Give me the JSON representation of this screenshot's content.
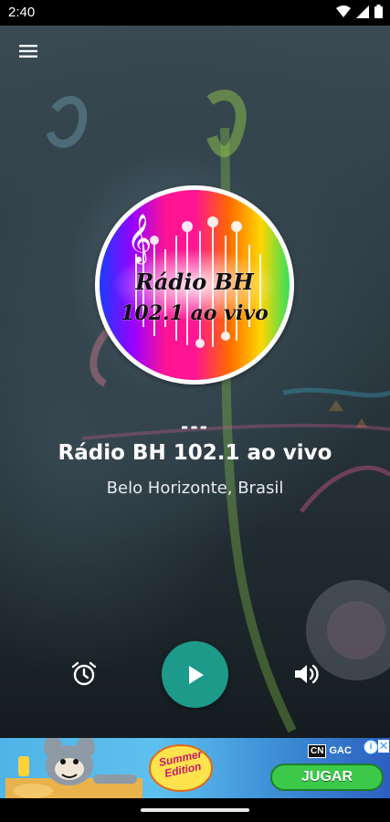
{
  "status_bar": {
    "time": "2:40",
    "icons": [
      "wifi-icon",
      "signal-icon",
      "battery-icon"
    ]
  },
  "header": {
    "menu_icon": "hamburger-menu-icon"
  },
  "logo": {
    "line1": "Rádio BH",
    "line2": "102.1 ao vivo"
  },
  "now_playing": {
    "track": "---",
    "station_name": "Rádio BH 102.1 ao vivo",
    "location": "Belo Horizonte, Brasil"
  },
  "controls": {
    "alarm_icon": "alarm-clock-icon",
    "play_icon": "play-icon",
    "volume_icon": "volume-icon"
  },
  "ad": {
    "sticker_text": "Summer Edition",
    "brand_logo": "CN",
    "brand_text": "GAC",
    "info_icon": "i",
    "close_icon": "✕",
    "cta_label": "JUGAR"
  },
  "colors": {
    "accent": "#1d9a8a",
    "cta": "#3cc94a"
  }
}
